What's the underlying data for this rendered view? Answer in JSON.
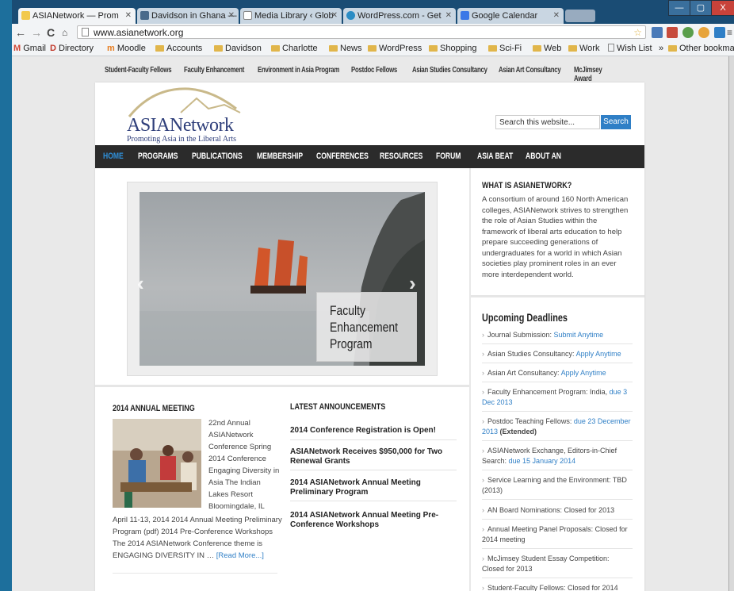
{
  "browser": {
    "tabs": [
      {
        "label": "ASIANetwork — Prom",
        "color": "#f2c94c"
      },
      {
        "label": "Davidson in Ghana —",
        "color": "#4a6a8a"
      },
      {
        "label": "Media Library ‹ Glob",
        "color": "#9fb7cf"
      },
      {
        "label": "WordPress.com - Get",
        "color": "#2b8cc4"
      },
      {
        "label": "Google Calendar",
        "color": "#3b78e7"
      }
    ],
    "url": "www.asianetwork.org",
    "window_buttons": [
      "—",
      "▢",
      "X"
    ],
    "bookmarks": [
      {
        "label": "Gmail",
        "kind": "gmail"
      },
      {
        "label": "Directory",
        "kind": "d"
      },
      {
        "label": "Moodle",
        "kind": "moodle"
      },
      {
        "label": "Accounts",
        "kind": "folder"
      },
      {
        "label": "Davidson",
        "kind": "folder"
      },
      {
        "label": "Charlotte",
        "kind": "folder"
      },
      {
        "label": "News",
        "kind": "folder"
      },
      {
        "label": "WordPress",
        "kind": "folder"
      },
      {
        "label": "Shopping",
        "kind": "folder"
      },
      {
        "label": "Sci-Fi",
        "kind": "folder"
      },
      {
        "label": "Web",
        "kind": "folder"
      },
      {
        "label": "Work",
        "kind": "folder"
      },
      {
        "label": "Wish List",
        "kind": "page"
      }
    ],
    "bookmarks_more": "»",
    "other_bookmarks": "Other bookmarks"
  },
  "site": {
    "top_nav": [
      "Student-Faculty Fellows",
      "Faculty Enhancement",
      "Environment in Asia Program",
      "Postdoc Fellows",
      "Asian Studies Consultancy",
      "Asian Art Consultancy",
      "McJimsey Award"
    ],
    "logo_title": "ASIANetwork",
    "logo_tagline": "Promoting Asia in the Liberal Arts",
    "search_placeholder": "Search this website...",
    "search_button": "Search",
    "main_nav": [
      "HOME",
      "PROGRAMS",
      "PUBLICATIONS",
      "MEMBERSHIP",
      "CONFERENCES",
      "RESOURCES",
      "FORUM",
      "ASIA BEAT",
      "ABOUT AN"
    ],
    "slide_caption": "Faculty Enhancement Program",
    "meeting": {
      "title": "2014 ANNUAL MEETING",
      "side_lines": [
        "22nd Annual",
        "ASIANetwork",
        "Conference Spring",
        "2014 Conference",
        "Engaging Diversity in",
        "Asia The Indian",
        "Lakes Resort",
        "Bloomingdale, IL"
      ],
      "full_lines": [
        "April 11-13, 2014 2014 Annual Meeting Preliminary",
        "Program (pdf) 2014 Pre-Conference Workshops",
        "The 2014 ASIANetwork Conference theme is",
        "ENGAGING DIVERSITY IN …"
      ],
      "read_more": "[Read More...]"
    },
    "announcements": {
      "title": "LATEST ANNOUNCEMENTS",
      "items": [
        "2014 Conference Registration is Open!",
        "ASIANetwork Receives $950,000 for Two Renewal Grants",
        "2014 ASIANetwork Annual Meeting Preliminary Program",
        "2014 ASIANetwork Annual Meeting Pre-Conference Workshops"
      ]
    },
    "about": {
      "title": "WHAT IS ASIANETWORK?",
      "lines": [
        "A consortium of around 160 North American",
        "colleges, ASIANetwork strives to strengthen",
        "the role of Asian Studies within the",
        "framework of liberal arts education to help",
        "prepare succeeding generations of",
        "undergraduates for a world in which Asian",
        "societies play prominent roles in an ever",
        "more interdependent world."
      ]
    },
    "deadlines": {
      "title": "Upcoming Deadlines",
      "items": [
        {
          "label": "Journal Submission: ",
          "link": "Submit Anytime",
          "extra": ""
        },
        {
          "label": "Asian Studies Consultancy: ",
          "link": "Apply Anytime",
          "extra": ""
        },
        {
          "label": "Asian Art Consultancy: ",
          "link": "Apply Anytime",
          "extra": ""
        },
        {
          "label": "Faculty Enhancement Program: India, ",
          "link": "due 3 Dec 2013",
          "extra": ""
        },
        {
          "label": "Postdoc Teaching Fellows: ",
          "link": "due 23 December 2013",
          "extra": " (Extended)"
        },
        {
          "label": "ASIANetwork Exchange, Editors-in-Chief Search: ",
          "link": "due 15 January 2014",
          "extra": ""
        },
        {
          "label": "Service Learning and the Environment: TBD (2013)",
          "link": "",
          "extra": ""
        },
        {
          "label": "AN Board Nominations: Closed for 2013",
          "link": "",
          "extra": ""
        },
        {
          "label": "Annual Meeting Panel Proposals: Closed for 2014 meeting",
          "link": "",
          "extra": ""
        },
        {
          "label": "McJimsey Student Essay Competition: Closed for 2013",
          "link": "",
          "extra": ""
        },
        {
          "label": "Student-Faculty Fellows: Closed for 2014",
          "link": "",
          "extra": ""
        }
      ]
    }
  }
}
